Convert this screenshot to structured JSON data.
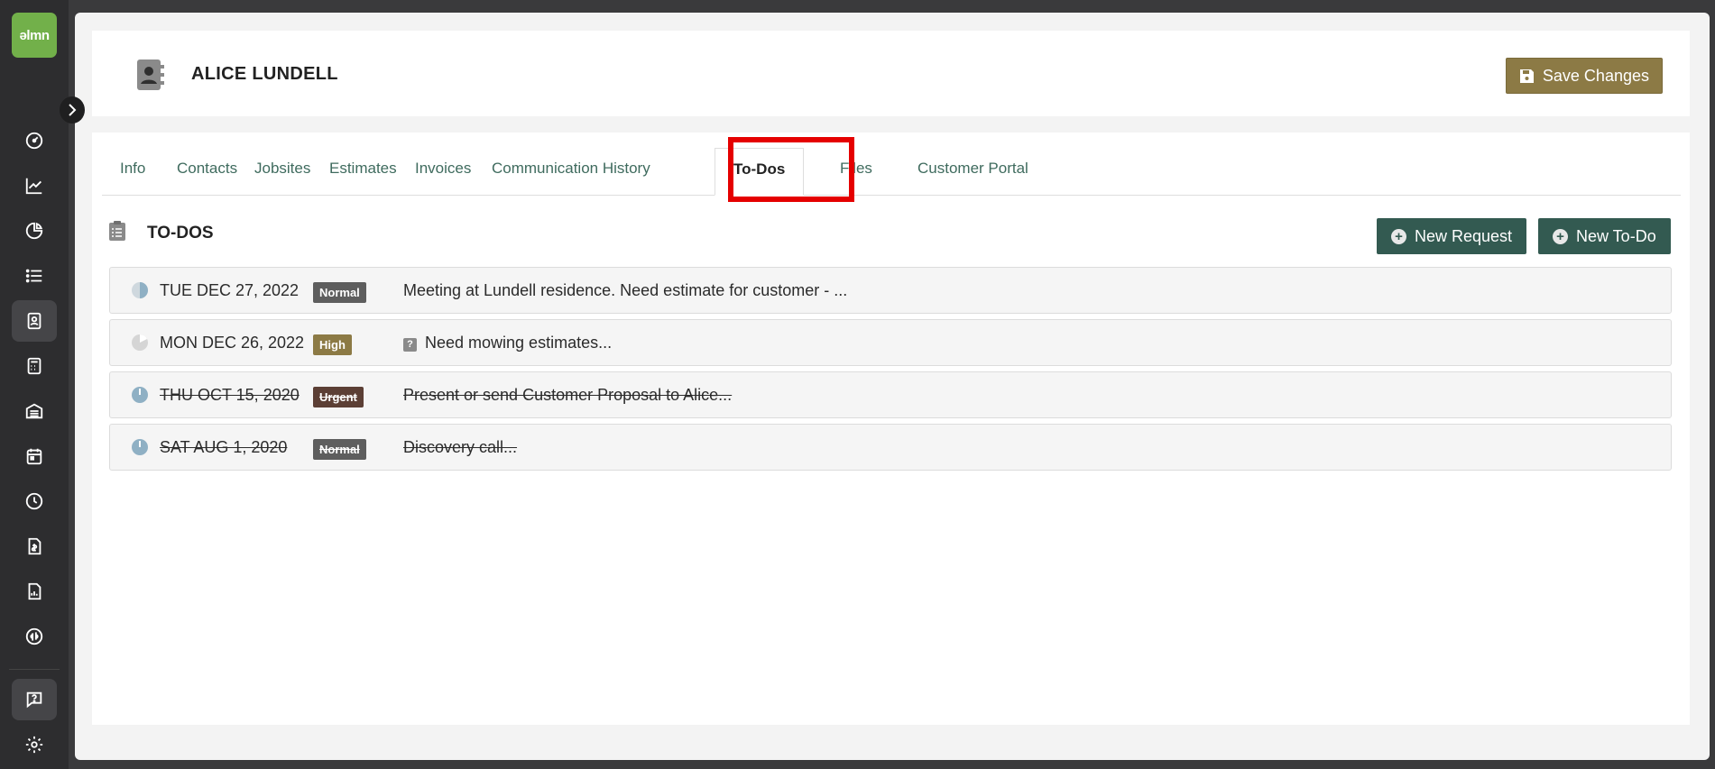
{
  "app": {
    "logo_text": "ǝlmn"
  },
  "sidebar": {
    "items": [
      {
        "name": "dashboard-icon",
        "active": false
      },
      {
        "name": "chart-line-icon",
        "active": false
      },
      {
        "name": "pie-chart-icon",
        "active": false
      },
      {
        "name": "list-icon",
        "active": false
      },
      {
        "name": "contact-card-icon",
        "active": true
      },
      {
        "name": "calculator-icon",
        "active": false
      },
      {
        "name": "garage-icon",
        "active": false
      },
      {
        "name": "calendar-icon",
        "active": false
      },
      {
        "name": "clock-icon",
        "active": false
      },
      {
        "name": "invoice-icon",
        "active": false
      },
      {
        "name": "report-icon",
        "active": false
      },
      {
        "name": "quickbooks-icon",
        "active": false
      },
      {
        "name": "help-icon",
        "active": false
      },
      {
        "name": "settings-icon",
        "active": false
      }
    ]
  },
  "header": {
    "customer_name": "ALICE LUNDELL",
    "save_label": "Save Changes"
  },
  "tabs": [
    {
      "label": "Info"
    },
    {
      "label": "Contacts"
    },
    {
      "label": "Jobsites"
    },
    {
      "label": "Estimates"
    },
    {
      "label": "Invoices"
    },
    {
      "label": "Communication History"
    },
    {
      "label": "To-Dos"
    },
    {
      "label": "Files"
    },
    {
      "label": "Customer Portal"
    }
  ],
  "active_tab": "To-Dos",
  "section": {
    "title": "TO-DOS",
    "new_request_label": "New Request",
    "new_todo_label": "New To-Do"
  },
  "todos": [
    {
      "date": "TUE DEC 27, 2022",
      "priority": "Normal",
      "description": "Meeting at Lundell residence. Need estimate for customer - ...",
      "completed": false,
      "priority_color": "#5e5e5e"
    },
    {
      "date": "MON DEC 26, 2022",
      "priority": "High",
      "description": "Need mowing estimates...",
      "completed": false,
      "priority_color": "#8c7a45",
      "has_question_icon": true
    },
    {
      "date": "THU OCT 15, 2020",
      "priority": "Urgent",
      "description": "Present or send Customer Proposal to Alice...",
      "completed": true,
      "priority_color": "#5c3f35"
    },
    {
      "date": "SAT AUG 1, 2020",
      "priority": "Normal",
      "description": "Discovery call...",
      "completed": true,
      "priority_color": "#5e5e5e"
    }
  ],
  "colors": {
    "accent_green": "#335a51",
    "save_gold": "#8c7a45",
    "logo_green": "#72b04a",
    "highlight_red": "#e50000"
  }
}
